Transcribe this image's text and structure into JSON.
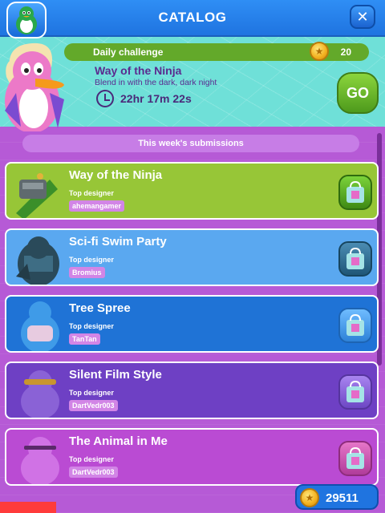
{
  "header": {
    "title": "CATALOG",
    "close_label": "✕"
  },
  "challenge": {
    "label": "Daily challenge",
    "reward": "20",
    "name": "Way of the Ninja",
    "description": "Blend in with the dark, dark night",
    "timer": "22hr 17m 22s",
    "go_label": "GO"
  },
  "submissions": {
    "tab_label": "This week's submissions",
    "top_designer_label": "Top designer",
    "items": [
      {
        "name": "Way of the Ninja",
        "designer": "ahemangamer",
        "bg": "#97c637",
        "name_color": "#fff"
      },
      {
        "name": "Sci-fi Swim Party",
        "designer": "Bromius",
        "bg": "#5aa8f0",
        "name_color": "#fff"
      },
      {
        "name": "Tree Spree",
        "designer": "TanTan",
        "bg": "#1f73d6",
        "name_color": "#fff"
      },
      {
        "name": "Silent Film Style",
        "designer": "DartVedr003",
        "bg": "#6e40c4",
        "name_color": "#fff"
      },
      {
        "name": "The Animal in Me",
        "designer": "DartVedr003",
        "bg": "#ba4bd3",
        "name_color": "#fff"
      }
    ]
  },
  "wallet": {
    "coins": "29511"
  },
  "colors": {
    "header": "#1f74e0",
    "challenge_bg": "#6fe0d8",
    "go_button": "#4e9a1c",
    "list_bg": "#b65ad6"
  }
}
